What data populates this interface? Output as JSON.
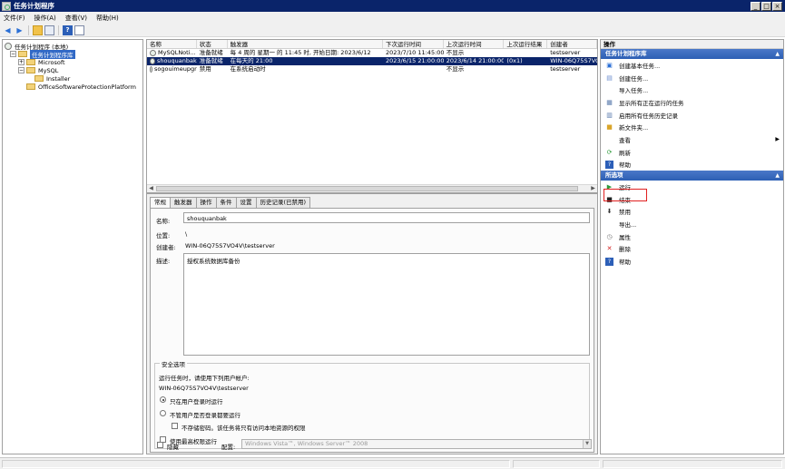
{
  "window": {
    "title": "任务计划程序",
    "minimize": "_",
    "maximize": "□",
    "close": "×"
  },
  "menu": [
    "文件(F)",
    "操作(A)",
    "查看(V)",
    "帮助(H)"
  ],
  "toolbar": {
    "back_icon": "◀",
    "forward_icon": "▶",
    "help_label": "?"
  },
  "tree": {
    "root": "任务计划程序 (本地)",
    "library": "任务计划程序库",
    "microsoft": "Microsoft",
    "mysql": "MySQL",
    "installer": "Installer",
    "office": "OfficeSoftwareProtectionPlatform"
  },
  "tasklist": {
    "columns": [
      "名称",
      "状态",
      "触发器",
      "下次运行时间",
      "上次运行时间",
      "上次运行结果",
      "创建者"
    ],
    "rows": [
      {
        "name": "MySQLNoti...",
        "status": "准备就绪",
        "trigger": "每 4 周的 星期一 的 11:45 时, 开始日期: 2023/6/12",
        "next": "2023/7/10 11:45:00",
        "last": "不显示",
        "result": "",
        "author": "testserver"
      },
      {
        "name": "shouquanbak",
        "status": "准备就绪",
        "trigger": "在每天的 21:00",
        "next": "2023/6/15 21:00:00",
        "last": "2023/6/14 21:00:00",
        "result": "(0x1)",
        "author": "WIN-06Q75S7VO4V"
      },
      {
        "name": "sogouimeupgr",
        "status": "禁用",
        "trigger": "在系统启动时",
        "next": "",
        "last": "不显示",
        "result": "",
        "author": "testserver"
      }
    ]
  },
  "detail": {
    "tabs": [
      "常规",
      "触发器",
      "操作",
      "条件",
      "设置",
      "历史记录(已禁用)"
    ],
    "name_label": "名称:",
    "name_value": "shouquanbak",
    "location_label": "位置:",
    "location_value": "\\",
    "author_label": "创建者:",
    "author_value": "WIN-06Q75S7VO4V\\testserver",
    "desc_label": "描述:",
    "desc_value": "授权系统数据库备份",
    "security": {
      "title": "安全选项",
      "run_as_label": "运行任务时，请使用下列用户帐户:",
      "run_as_user": "WIN-06Q75S7VO4V\\testserver",
      "opt_logged_on": "只在用户登录时运行",
      "opt_any": "不管用户是否登录都要运行",
      "no_store_pwd": "不存储密码。该任务将只有访问本地资源的权限",
      "highest": "使用最高权限运行"
    },
    "hidden_label": "隐藏",
    "config_label": "配置:",
    "config_value": "Windows Vista™, Windows Server™ 2008"
  },
  "actions": {
    "header": "操作",
    "section1": "任务计划程序库",
    "items1": [
      "创建基本任务...",
      "创建任务...",
      "导入任务...",
      "显示所有正在运行的任务",
      "启用所有任务历史记录",
      "新文件夹...",
      "查看",
      "刷新",
      "帮助"
    ],
    "section2": "所选项",
    "items2": [
      "运行",
      "结束",
      "禁用",
      "导出...",
      "属性",
      "删除",
      "帮助"
    ]
  }
}
